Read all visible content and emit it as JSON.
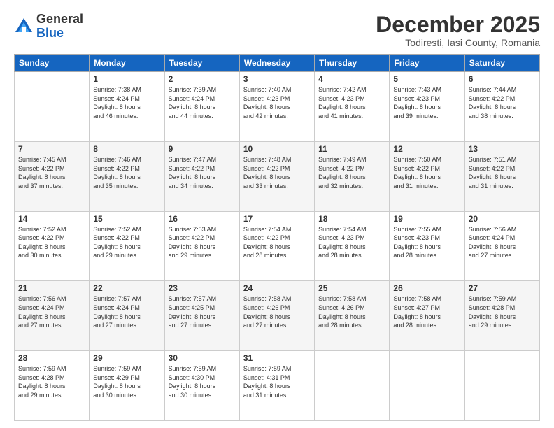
{
  "logo": {
    "general": "General",
    "blue": "Blue"
  },
  "header": {
    "month": "December 2025",
    "location": "Todiresti, Iasi County, Romania"
  },
  "weekdays": [
    "Sunday",
    "Monday",
    "Tuesday",
    "Wednesday",
    "Thursday",
    "Friday",
    "Saturday"
  ],
  "weeks": [
    [
      {
        "day": "",
        "sunrise": "",
        "sunset": "",
        "daylight": ""
      },
      {
        "day": "1",
        "sunrise": "Sunrise: 7:38 AM",
        "sunset": "Sunset: 4:24 PM",
        "daylight": "Daylight: 8 hours and 46 minutes."
      },
      {
        "day": "2",
        "sunrise": "Sunrise: 7:39 AM",
        "sunset": "Sunset: 4:24 PM",
        "daylight": "Daylight: 8 hours and 44 minutes."
      },
      {
        "day": "3",
        "sunrise": "Sunrise: 7:40 AM",
        "sunset": "Sunset: 4:23 PM",
        "daylight": "Daylight: 8 hours and 42 minutes."
      },
      {
        "day": "4",
        "sunrise": "Sunrise: 7:42 AM",
        "sunset": "Sunset: 4:23 PM",
        "daylight": "Daylight: 8 hours and 41 minutes."
      },
      {
        "day": "5",
        "sunrise": "Sunrise: 7:43 AM",
        "sunset": "Sunset: 4:23 PM",
        "daylight": "Daylight: 8 hours and 39 minutes."
      },
      {
        "day": "6",
        "sunrise": "Sunrise: 7:44 AM",
        "sunset": "Sunset: 4:22 PM",
        "daylight": "Daylight: 8 hours and 38 minutes."
      }
    ],
    [
      {
        "day": "7",
        "sunrise": "Sunrise: 7:45 AM",
        "sunset": "Sunset: 4:22 PM",
        "daylight": "Daylight: 8 hours and 37 minutes."
      },
      {
        "day": "8",
        "sunrise": "Sunrise: 7:46 AM",
        "sunset": "Sunset: 4:22 PM",
        "daylight": "Daylight: 8 hours and 35 minutes."
      },
      {
        "day": "9",
        "sunrise": "Sunrise: 7:47 AM",
        "sunset": "Sunset: 4:22 PM",
        "daylight": "Daylight: 8 hours and 34 minutes."
      },
      {
        "day": "10",
        "sunrise": "Sunrise: 7:48 AM",
        "sunset": "Sunset: 4:22 PM",
        "daylight": "Daylight: 8 hours and 33 minutes."
      },
      {
        "day": "11",
        "sunrise": "Sunrise: 7:49 AM",
        "sunset": "Sunset: 4:22 PM",
        "daylight": "Daylight: 8 hours and 32 minutes."
      },
      {
        "day": "12",
        "sunrise": "Sunrise: 7:50 AM",
        "sunset": "Sunset: 4:22 PM",
        "daylight": "Daylight: 8 hours and 31 minutes."
      },
      {
        "day": "13",
        "sunrise": "Sunrise: 7:51 AM",
        "sunset": "Sunset: 4:22 PM",
        "daylight": "Daylight: 8 hours and 31 minutes."
      }
    ],
    [
      {
        "day": "14",
        "sunrise": "Sunrise: 7:52 AM",
        "sunset": "Sunset: 4:22 PM",
        "daylight": "Daylight: 8 hours and 30 minutes."
      },
      {
        "day": "15",
        "sunrise": "Sunrise: 7:52 AM",
        "sunset": "Sunset: 4:22 PM",
        "daylight": "Daylight: 8 hours and 29 minutes."
      },
      {
        "day": "16",
        "sunrise": "Sunrise: 7:53 AM",
        "sunset": "Sunset: 4:22 PM",
        "daylight": "Daylight: 8 hours and 29 minutes."
      },
      {
        "day": "17",
        "sunrise": "Sunrise: 7:54 AM",
        "sunset": "Sunset: 4:22 PM",
        "daylight": "Daylight: 8 hours and 28 minutes."
      },
      {
        "day": "18",
        "sunrise": "Sunrise: 7:54 AM",
        "sunset": "Sunset: 4:23 PM",
        "daylight": "Daylight: 8 hours and 28 minutes."
      },
      {
        "day": "19",
        "sunrise": "Sunrise: 7:55 AM",
        "sunset": "Sunset: 4:23 PM",
        "daylight": "Daylight: 8 hours and 28 minutes."
      },
      {
        "day": "20",
        "sunrise": "Sunrise: 7:56 AM",
        "sunset": "Sunset: 4:24 PM",
        "daylight": "Daylight: 8 hours and 27 minutes."
      }
    ],
    [
      {
        "day": "21",
        "sunrise": "Sunrise: 7:56 AM",
        "sunset": "Sunset: 4:24 PM",
        "daylight": "Daylight: 8 hours and 27 minutes."
      },
      {
        "day": "22",
        "sunrise": "Sunrise: 7:57 AM",
        "sunset": "Sunset: 4:24 PM",
        "daylight": "Daylight: 8 hours and 27 minutes."
      },
      {
        "day": "23",
        "sunrise": "Sunrise: 7:57 AM",
        "sunset": "Sunset: 4:25 PM",
        "daylight": "Daylight: 8 hours and 27 minutes."
      },
      {
        "day": "24",
        "sunrise": "Sunrise: 7:58 AM",
        "sunset": "Sunset: 4:26 PM",
        "daylight": "Daylight: 8 hours and 27 minutes."
      },
      {
        "day": "25",
        "sunrise": "Sunrise: 7:58 AM",
        "sunset": "Sunset: 4:26 PM",
        "daylight": "Daylight: 8 hours and 28 minutes."
      },
      {
        "day": "26",
        "sunrise": "Sunrise: 7:58 AM",
        "sunset": "Sunset: 4:27 PM",
        "daylight": "Daylight: 8 hours and 28 minutes."
      },
      {
        "day": "27",
        "sunrise": "Sunrise: 7:59 AM",
        "sunset": "Sunset: 4:28 PM",
        "daylight": "Daylight: 8 hours and 29 minutes."
      }
    ],
    [
      {
        "day": "28",
        "sunrise": "Sunrise: 7:59 AM",
        "sunset": "Sunset: 4:28 PM",
        "daylight": "Daylight: 8 hours and 29 minutes."
      },
      {
        "day": "29",
        "sunrise": "Sunrise: 7:59 AM",
        "sunset": "Sunset: 4:29 PM",
        "daylight": "Daylight: 8 hours and 30 minutes."
      },
      {
        "day": "30",
        "sunrise": "Sunrise: 7:59 AM",
        "sunset": "Sunset: 4:30 PM",
        "daylight": "Daylight: 8 hours and 30 minutes."
      },
      {
        "day": "31",
        "sunrise": "Sunrise: 7:59 AM",
        "sunset": "Sunset: 4:31 PM",
        "daylight": "Daylight: 8 hours and 31 minutes."
      },
      {
        "day": "",
        "sunrise": "",
        "sunset": "",
        "daylight": ""
      },
      {
        "day": "",
        "sunrise": "",
        "sunset": "",
        "daylight": ""
      },
      {
        "day": "",
        "sunrise": "",
        "sunset": "",
        "daylight": ""
      }
    ]
  ]
}
